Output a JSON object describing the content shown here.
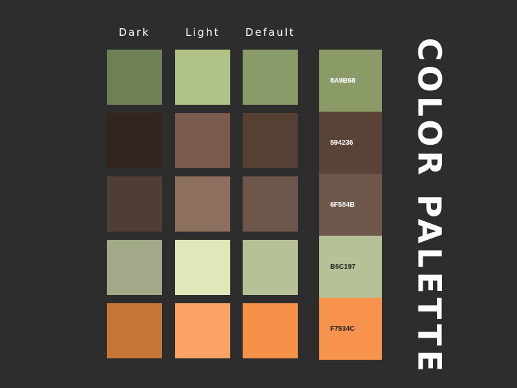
{
  "columns": {
    "dark": "Dark",
    "light": "Light",
    "default": "Default"
  },
  "rows": [
    {
      "dark": "#6f7f56",
      "light": "#b0c285",
      "default": "#8a9b6a"
    },
    {
      "dark": "#33241f",
      "light": "#7b5b4d",
      "default": "#563f33"
    },
    {
      "dark": "#4e3e35",
      "light": "#8e705f",
      "default": "#6e574a"
    },
    {
      "dark": "#a2a988",
      "light": "#e0e8b9",
      "default": "#b7c197"
    },
    {
      "dark": "#c8753a",
      "light": "#fba364",
      "default": "#f59149"
    }
  ],
  "strip": [
    {
      "code": "8A9B68",
      "color": "#8a9b68",
      "text_color": "#ffffff"
    },
    {
      "code": "594236",
      "color": "#594236",
      "text_color": "#ffffff"
    },
    {
      "code": "6F584B",
      "color": "#6f584b",
      "text_color": "#ffffff"
    },
    {
      "code": "B6C197",
      "color": "#b6c197",
      "text_color": "#222222"
    },
    {
      "code": "F7934C",
      "color": "#f7934c",
      "text_color": "#222222"
    }
  ],
  "title": "COLOR PALETTE"
}
